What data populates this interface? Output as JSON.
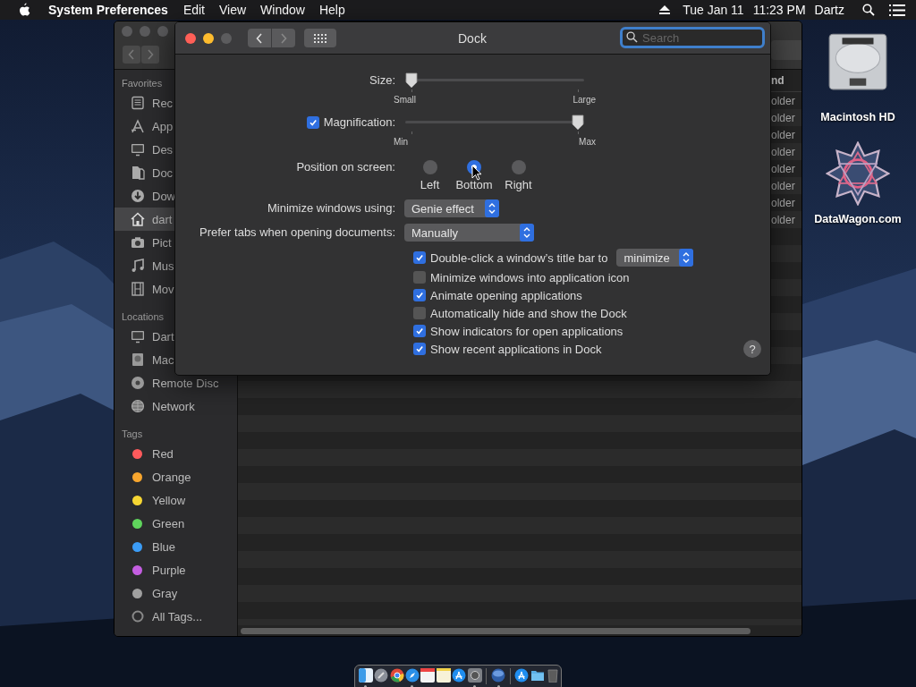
{
  "menu_bar": {
    "app_name": "System Preferences",
    "menus": [
      "Edit",
      "View",
      "Window",
      "Help"
    ],
    "date": "Tue Jan 11",
    "time": "11:23 PM",
    "user": "Dartz"
  },
  "finder": {
    "sidebar": [
      {
        "heading": "Favorites",
        "items": [
          {
            "label": "Rec",
            "kind": "recents",
            "selected": false
          },
          {
            "label": "App",
            "kind": "apps",
            "selected": false
          },
          {
            "label": "Des",
            "kind": "desktop",
            "selected": false
          },
          {
            "label": "Doc",
            "kind": "documents",
            "selected": false
          },
          {
            "label": "Dow",
            "kind": "downloads",
            "selected": false
          },
          {
            "label": "dart",
            "kind": "home",
            "selected": true
          },
          {
            "label": "Pict",
            "kind": "pictures",
            "selected": false
          },
          {
            "label": "Mus",
            "kind": "music",
            "selected": false
          },
          {
            "label": "Mov",
            "kind": "movies",
            "selected": false
          }
        ]
      },
      {
        "heading": "Locations",
        "items": [
          {
            "label": "Dart",
            "kind": "computer",
            "selected": false
          },
          {
            "label": "Mac",
            "kind": "disk",
            "selected": false
          },
          {
            "label": "Remote Disc",
            "kind": "disc",
            "selected": false
          },
          {
            "label": "Network",
            "kind": "network",
            "selected": false
          }
        ]
      },
      {
        "heading": "Tags",
        "items": [
          {
            "label": "Red",
            "kind": "tag",
            "color": "#fd5a5c",
            "selected": false
          },
          {
            "label": "Orange",
            "kind": "tag",
            "color": "#f8a62e",
            "selected": false
          },
          {
            "label": "Yellow",
            "kind": "tag",
            "color": "#f6d633",
            "selected": false
          },
          {
            "label": "Green",
            "kind": "tag",
            "color": "#5fd45c",
            "selected": false
          },
          {
            "label": "Blue",
            "kind": "tag",
            "color": "#3b9cf6",
            "selected": false
          },
          {
            "label": "Purple",
            "kind": "tag",
            "color": "#c45ee1",
            "selected": false
          },
          {
            "label": "Gray",
            "kind": "tag",
            "color": "#a0a0a0",
            "selected": false
          },
          {
            "label": "All Tags...",
            "kind": "alltags",
            "selected": false
          }
        ]
      }
    ],
    "column_header": "nd",
    "rows": [
      "older",
      "older",
      "older",
      "older",
      "older",
      "older",
      "older",
      "older"
    ]
  },
  "dock_prefs": {
    "title": "Dock",
    "search": {
      "placeholder": "Search"
    },
    "size": {
      "label": "Size:",
      "level": 0,
      "min_label": "Small",
      "max_label": "Large"
    },
    "magnification": {
      "label": "Magnification:",
      "checked": true,
      "level": 1,
      "min_label": "Min",
      "max_label": "Max"
    },
    "position": {
      "label": "Position on screen:",
      "options": [
        {
          "label": "Left",
          "selected": false
        },
        {
          "label": "Bottom",
          "selected": true
        },
        {
          "label": "Right",
          "selected": false
        }
      ]
    },
    "minimize_using": {
      "label": "Minimize windows using:",
      "value": "Genie effect"
    },
    "prefer_tabs": {
      "label": "Prefer tabs when opening documents:",
      "value": "Manually"
    },
    "options": [
      {
        "label": "Double-click a window’s title bar to",
        "checked": true,
        "popup": "minimize"
      },
      {
        "label": "Minimize windows into application icon",
        "checked": false
      },
      {
        "label": "Animate opening applications",
        "checked": true
      },
      {
        "label": "Automatically hide and show the Dock",
        "checked": false
      },
      {
        "label": "Show indicators for open applications",
        "checked": true
      },
      {
        "label": "Show recent applications in Dock",
        "checked": true
      }
    ],
    "help": "?"
  },
  "desktop_icons": [
    {
      "label": "Macintosh HD",
      "kind": "drive"
    },
    {
      "label": "DataWagon.com",
      "kind": "starburst"
    }
  ],
  "dock": {
    "apps": [
      {
        "kind": "finder",
        "running": true
      },
      {
        "kind": "launchpad",
        "running": false
      },
      {
        "kind": "chrome",
        "running": false
      },
      {
        "kind": "safari",
        "running": true
      },
      {
        "kind": "calendar",
        "running": false
      },
      {
        "kind": "notes",
        "running": false
      },
      {
        "kind": "appstore",
        "running": false
      },
      {
        "kind": "settings",
        "running": true
      }
    ],
    "recent": [
      {
        "kind": "globe",
        "running": true
      }
    ],
    "others": [
      {
        "kind": "appstore",
        "running": false
      },
      {
        "kind": "folder",
        "running": false
      },
      {
        "kind": "trash",
        "running": false
      }
    ]
  }
}
